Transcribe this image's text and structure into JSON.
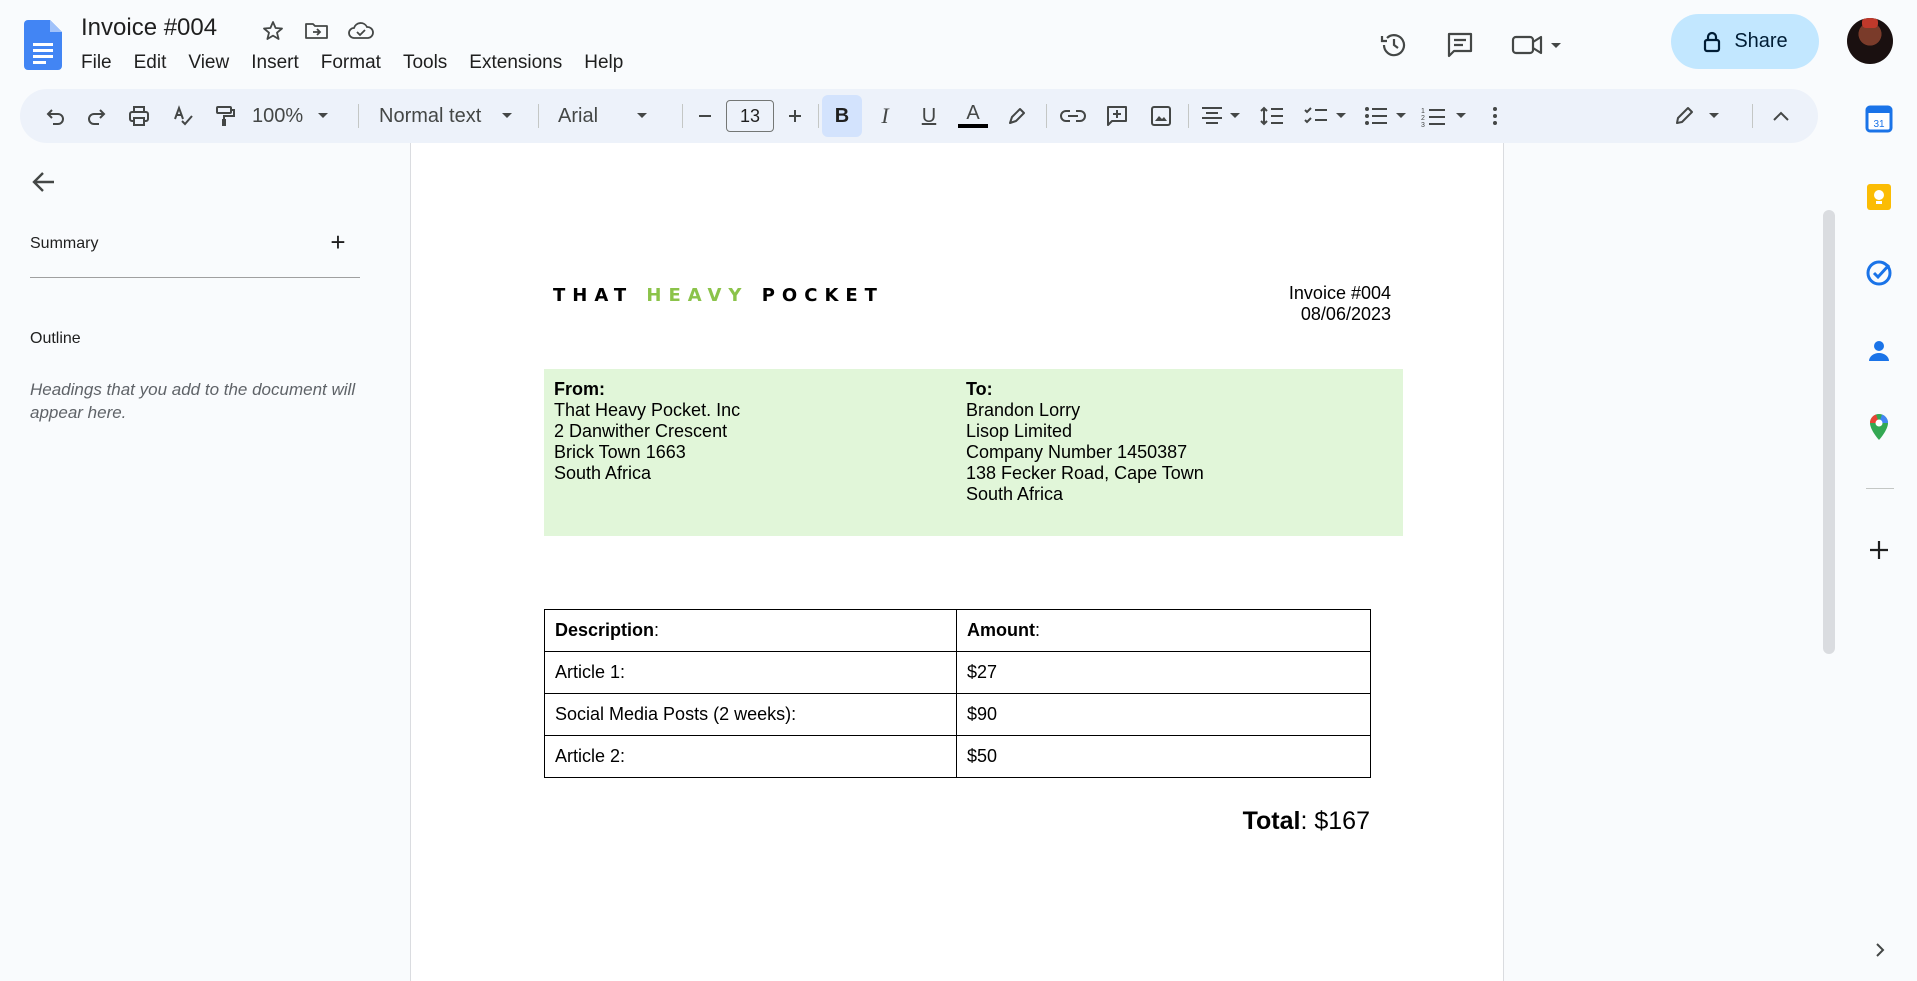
{
  "doc": {
    "title": "Invoice #004"
  },
  "menu": [
    "File",
    "Edit",
    "View",
    "Insert",
    "Format",
    "Tools",
    "Extensions",
    "Help"
  ],
  "header": {
    "share_label": "Share"
  },
  "toolbar": {
    "zoom": "100%",
    "style": "Normal text",
    "font": "Arial",
    "font_size": "13",
    "bold_label": "B",
    "italic_label": "I",
    "underline_label": "U",
    "text_color_label": "A"
  },
  "sidepanel": {
    "summary_label": "Summary",
    "add_label": "+",
    "outline_label": "Outline",
    "outline_hint": "Headings that you add to the document will appear here."
  },
  "document": {
    "brand_part1": "THAT ",
    "brand_part2": "HEAVY",
    "brand_part3": " POCKET",
    "brand_highlight_color": "#8bc34a",
    "invoice_number": "Invoice #004",
    "invoice_date": "08/06/2023",
    "from": {
      "label": "From:",
      "lines": [
        "That Heavy Pocket. Inc",
        "2 Danwither Crescent",
        "Brick Town 1663",
        "South Africa"
      ]
    },
    "to": {
      "label": "To:",
      "lines": [
        "Brandon Lorry",
        "Lisop Limited",
        "Company Number 1450387",
        "138 Fecker Road, Cape Town",
        "South Africa"
      ]
    },
    "table": {
      "header_desc": "Description",
      "header_amount": "Amount",
      "colon": ":",
      "rows": [
        {
          "desc": "Article 1:",
          "amount": "$27"
        },
        {
          "desc": "Social Media Posts (2 weeks):",
          "amount": "$90"
        },
        {
          "desc": "Article 2:",
          "amount": "$50"
        }
      ]
    },
    "total_label": "Total",
    "total_value": ": $167"
  },
  "colors": {
    "share_bg": "#c2e7ff",
    "toolbar_bg": "#edf2fa",
    "address_bg": "#e1f6d9",
    "bold_active_bg": "#d3e3fd"
  }
}
